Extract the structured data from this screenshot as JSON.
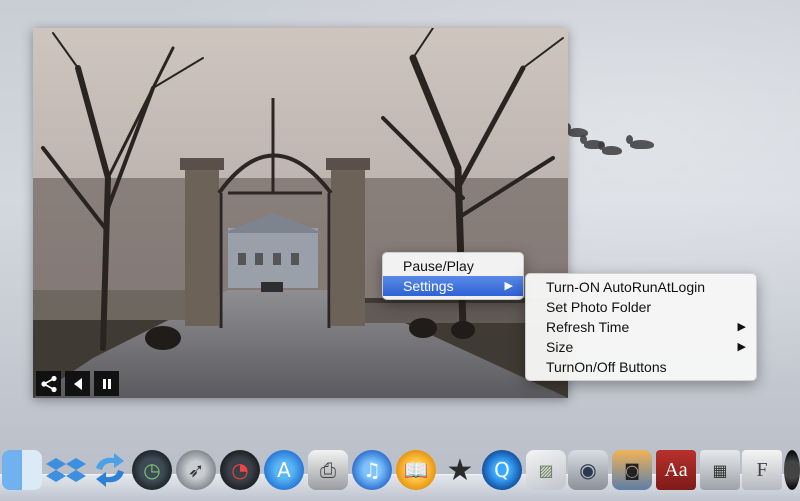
{
  "slideshow": {
    "controls": {
      "share_icon": "share-icon",
      "previous_icon": "previous-icon",
      "pause_icon": "pause-icon"
    }
  },
  "context_menu": {
    "items": [
      {
        "label": "Pause/Play"
      },
      {
        "label": "Settings",
        "highlighted": true,
        "has_submenu": true
      }
    ]
  },
  "settings_submenu": {
    "items": [
      {
        "label": "Turn-ON AutoRunAtLogin"
      },
      {
        "label": "Set Photo Folder"
      },
      {
        "label": "Refresh Time",
        "has_submenu": true
      },
      {
        "label": "Size",
        "has_submenu": true
      },
      {
        "label": "TurnOn/Off Buttons"
      }
    ]
  },
  "submenu_arrow_glyph": "▶",
  "dock": {
    "icons": [
      {
        "name": "finder-icon"
      },
      {
        "name": "dropbox-icon"
      },
      {
        "name": "sync-icon"
      },
      {
        "name": "time-machine-icon"
      },
      {
        "name": "launchpad-icon"
      },
      {
        "name": "dashboard-icon"
      },
      {
        "name": "app-store-icon"
      },
      {
        "name": "printer-icon"
      },
      {
        "name": "itunes-icon"
      },
      {
        "name": "ibooks-icon"
      },
      {
        "name": "imovie-icon"
      },
      {
        "name": "quicktime-icon"
      },
      {
        "name": "preview-icon"
      },
      {
        "name": "facetime-icon"
      },
      {
        "name": "iphoto-icon"
      },
      {
        "name": "dictionary-icon",
        "text": "Aa"
      },
      {
        "name": "calculator-icon"
      },
      {
        "name": "font-book-icon",
        "text": "F"
      }
    ]
  }
}
